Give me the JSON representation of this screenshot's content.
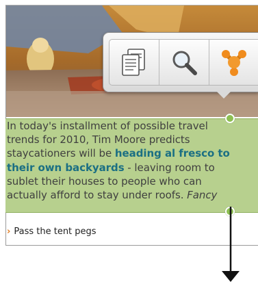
{
  "article": {
    "lines": [
      "In today's installment of possible travel",
      "trends for 2010, Tim Moore predicts",
      "staycationers will be ",
      "heading al fresco to",
      "their own backyards",
      " - leaving room to",
      "sublet their houses to people who can",
      "actually afford to stay under roofs. ",
      "Fancy"
    ]
  },
  "caption": {
    "text": "Pass the tent pegs"
  },
  "popup": {
    "buttons": [
      {
        "name": "copy-icon"
      },
      {
        "name": "search-icon"
      },
      {
        "name": "share-icon"
      }
    ]
  },
  "colors": {
    "selection": "#b7d08e",
    "link": "#1b6f83",
    "handle": "#8dbf52",
    "chevron": "#e07a1e"
  }
}
